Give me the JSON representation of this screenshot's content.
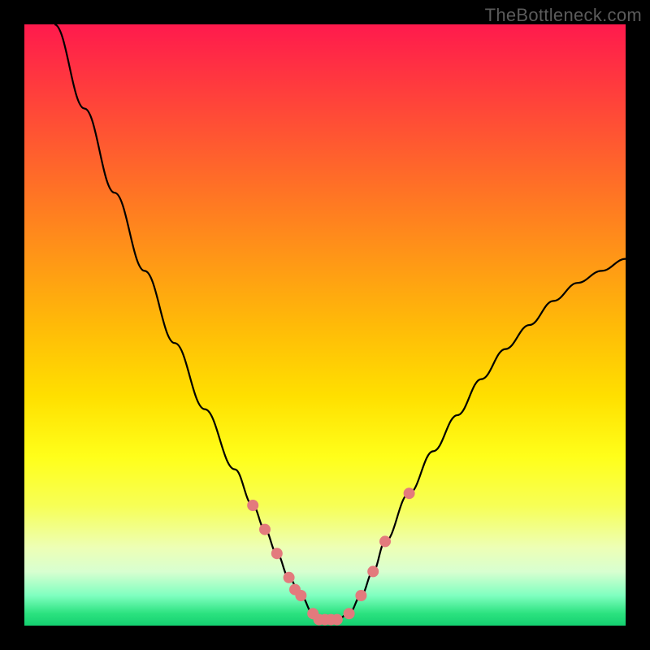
{
  "watermark": "TheBottleneck.com",
  "colors": {
    "frame_bg": "#000000",
    "curve": "#000000",
    "marker": "#e37a7d",
    "gradient_top": "#ff1a4d",
    "gradient_bottom": "#14d070"
  },
  "chart_data": {
    "type": "line",
    "title": "",
    "xlabel": "",
    "ylabel": "",
    "xlim": [
      0,
      100
    ],
    "ylim": [
      0,
      100
    ],
    "x": [
      5,
      10,
      15,
      20,
      25,
      30,
      35,
      38,
      40,
      42,
      44,
      46,
      48,
      50,
      52,
      54,
      56,
      58,
      60,
      64,
      68,
      72,
      76,
      80,
      84,
      88,
      92,
      96,
      100
    ],
    "series": [
      {
        "name": "bottleneck-curve",
        "values": [
          100,
          86,
          72,
          59,
          47,
          36,
          26,
          20,
          16,
          12,
          8,
          5,
          2,
          1,
          1,
          2,
          5,
          9,
          14,
          22,
          29,
          35,
          41,
          46,
          50,
          54,
          57,
          59,
          61
        ]
      }
    ],
    "markers": {
      "name": "highlight-points",
      "x": [
        38,
        40,
        42,
        44,
        45,
        46,
        48,
        49,
        50,
        51,
        52,
        54,
        56,
        58,
        60,
        64
      ],
      "y": [
        20,
        16,
        12,
        8,
        6,
        5,
        2,
        1,
        1,
        1,
        1,
        2,
        5,
        9,
        14,
        22
      ]
    }
  }
}
